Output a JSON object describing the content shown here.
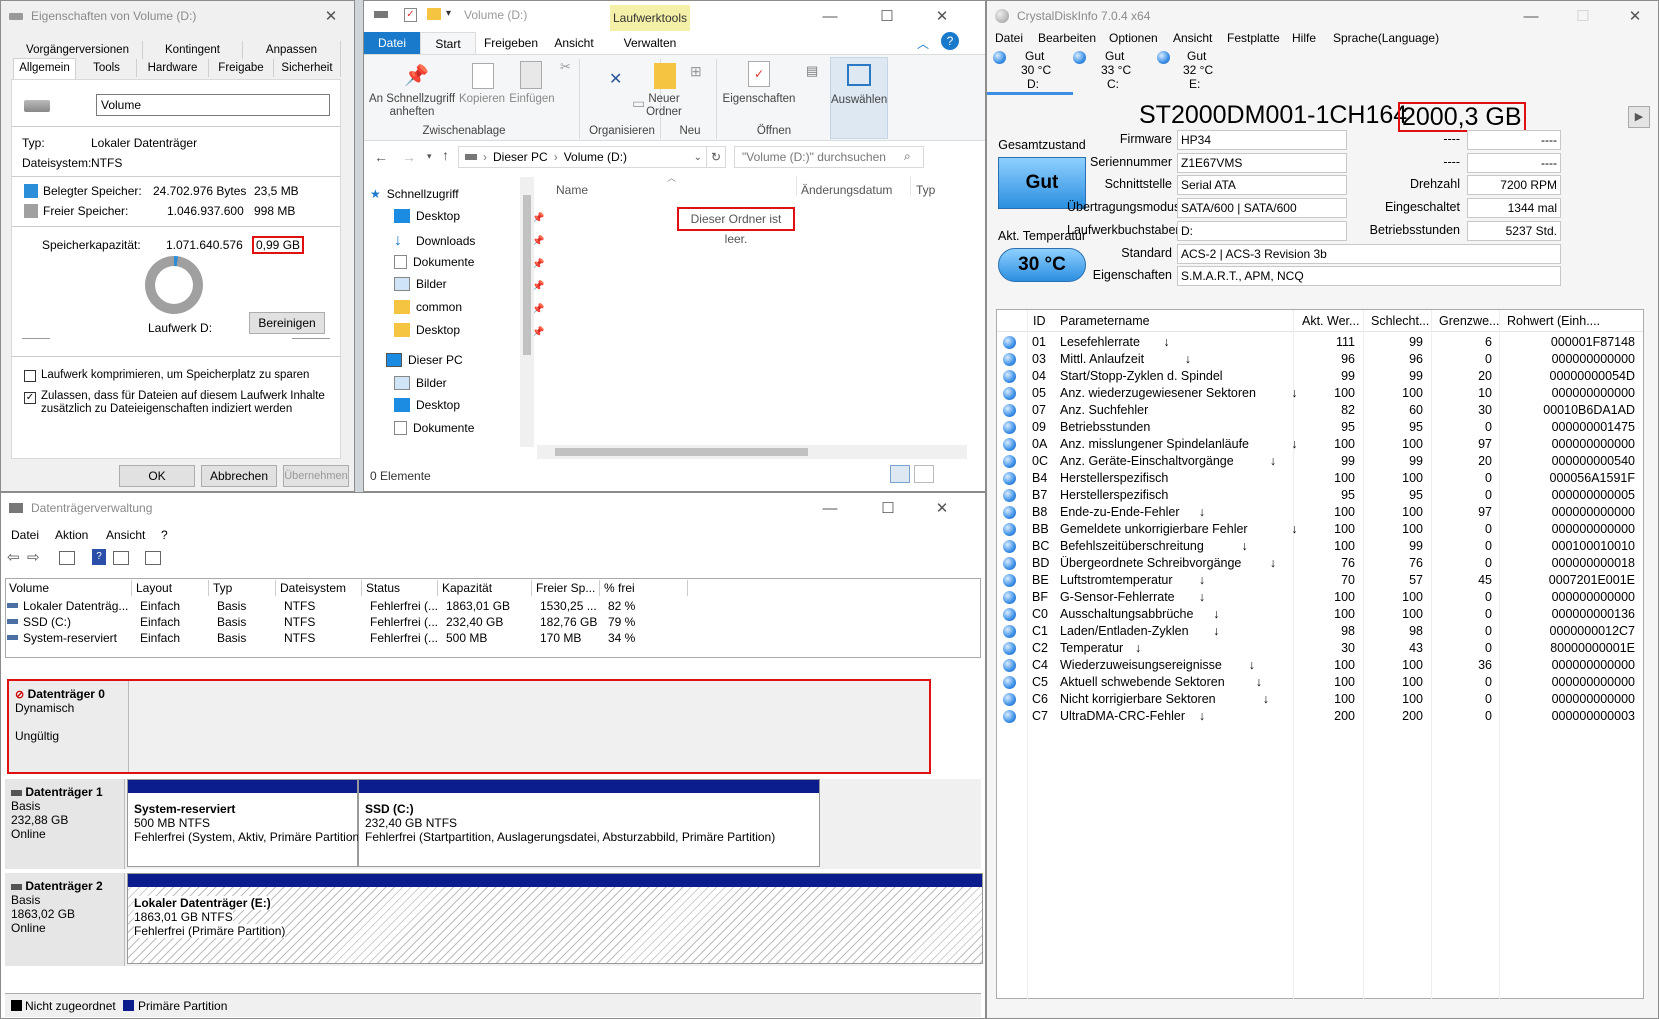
{
  "props": {
    "title": "Eigenschaften von Volume (D:)",
    "tabs_row1": [
      "Vorgängerversionen",
      "Kontingent",
      "Anpassen"
    ],
    "tabs_row2": [
      "Allgemein",
      "Tools",
      "Hardware",
      "Freigabe",
      "Sicherheit"
    ],
    "volume_name": "Volume",
    "type_label": "Typ:",
    "type_value": "Lokaler Datenträger",
    "fs_label": "Dateisystem:",
    "fs_value": "NTFS",
    "used_label": "Belegter Speicher:",
    "used_bytes": "24.702.976 Bytes",
    "used_mb": "23,5 MB",
    "free_label": "Freier Speicher:",
    "free_bytes": "1.046.937.600",
    "free_mb": "998 MB",
    "cap_label": "Speicherkapazität:",
    "cap_bytes": "1.071.640.576",
    "cap_gb": "0,99 GB",
    "drive_label": "Laufwerk D:",
    "cleanup": "Bereinigen",
    "compress": "Laufwerk komprimieren, um Speicherplatz zu sparen",
    "index_line1": "Zulassen, dass für Dateien auf diesem Laufwerk Inhalte",
    "index_line2": "zusätzlich zu Dateieigenschaften indiziert werden",
    "ok": "OK",
    "cancel": "Abbrechen",
    "apply": "Übernehmen",
    "used_color": "#2a8fd8",
    "free_color": "#a0a0a0"
  },
  "explorer": {
    "title": "Volume (D:)",
    "context_tab": "Laufwerktools",
    "tabs": [
      "Datei",
      "Start",
      "Freigeben",
      "Ansicht",
      "Verwalten"
    ],
    "ribbon": {
      "pin_line1": "An Schnellzugriff",
      "pin_line2": "anheften",
      "copy": "Kopieren",
      "paste": "Einfügen",
      "new_folder_line1": "Neuer",
      "new_folder_line2": "Ordner",
      "properties": "Eigenschaften",
      "select": "Auswählen",
      "group_clipboard": "Zwischenablage",
      "group_organize": "Organisieren",
      "group_new": "Neu",
      "group_open": "Öffnen"
    },
    "breadcrumb": [
      "Dieser PC",
      "Volume (D:)"
    ],
    "search_placeholder": "\"Volume (D:)\" durchsuchen",
    "nav": [
      {
        "label": "Schnellzugriff"
      },
      {
        "label": "Desktop"
      },
      {
        "label": "Downloads"
      },
      {
        "label": "Dokumente"
      },
      {
        "label": "Bilder"
      },
      {
        "label": "common"
      },
      {
        "label": "Desktop"
      },
      {
        "label": "Dieser PC"
      },
      {
        "label": "Bilder"
      },
      {
        "label": "Desktop"
      },
      {
        "label": "Dokumente"
      }
    ],
    "col_name": "Name",
    "col_date": "Änderungsdatum",
    "col_type": "Typ",
    "empty_msg": "Dieser Ordner ist leer.",
    "status": "0 Elemente"
  },
  "dm": {
    "title": "Datenträgerverwaltung",
    "menu": [
      "Datei",
      "Aktion",
      "Ansicht",
      "?"
    ],
    "columns": [
      "Volume",
      "Layout",
      "Typ",
      "Dateisystem",
      "Status",
      "Kapazität",
      "Freier Sp...",
      "% frei"
    ],
    "rows": [
      [
        "Lokaler Datenträg...",
        "Einfach",
        "Basis",
        "NTFS",
        "Fehlerfrei (...",
        "1863,01 GB",
        "1530,25 ...",
        "82 %"
      ],
      [
        "SSD (C:)",
        "Einfach",
        "Basis",
        "NTFS",
        "Fehlerfrei (...",
        "232,40 GB",
        "182,76 GB",
        "79 %"
      ],
      [
        "System-reserviert",
        "Einfach",
        "Basis",
        "NTFS",
        "Fehlerfrei (...",
        "500 MB",
        "170 MB",
        "34 %"
      ]
    ],
    "disk0": {
      "name": "Datenträger 0",
      "type": "Dynamisch",
      "status": "Ungültig"
    },
    "disk1": {
      "name": "Datenträger 1",
      "type": "Basis",
      "size": "232,88 GB",
      "status": "Online",
      "p1_name": "System-reserviert",
      "p1_size": "500 MB NTFS",
      "p1_status": "Fehlerfrei (System, Aktiv, Primäre Partition)",
      "p2_name": "SSD  (C:)",
      "p2_size": "232,40 GB NTFS",
      "p2_status": "Fehlerfrei (Startpartition, Auslagerungsdatei, Absturzabbild, Primäre Partition)"
    },
    "disk2": {
      "name": "Datenträger 2",
      "type": "Basis",
      "size": "1863,02 GB",
      "status": "Online",
      "p1_name": "Lokaler Datenträger  (E:)",
      "p1_size": "1863,01 GB NTFS",
      "p1_status": "Fehlerfrei (Primäre Partition)"
    },
    "legend_unalloc": "Nicht zugeordnet",
    "legend_primary": "Primäre Partition",
    "primary_color": "#0b1d8c"
  },
  "cdi": {
    "title": "CrystalDiskInfo 7.0.4 x64",
    "menu": [
      "Datei",
      "Bearbeiten",
      "Optionen",
      "Ansicht",
      "Festplatte",
      "Hilfe",
      "Sprache(Language)"
    ],
    "drives": [
      {
        "state": "Gut",
        "temp": "30 °C",
        "letter": "D:"
      },
      {
        "state": "Gut",
        "temp": "33 °C",
        "letter": "C:"
      },
      {
        "state": "Gut",
        "temp": "32 °C",
        "letter": "E:"
      }
    ],
    "model": "ST2000DM001-1CH164",
    "capacity": "2000,3 GB",
    "health_label": "Gesamtzustand",
    "health_value": "Gut",
    "temp_label": "Akt. Temperatur",
    "temp_value": "30 °C",
    "fields_left": [
      {
        "label": "Firmware",
        "value": "HP34"
      },
      {
        "label": "Seriennummer",
        "value": "Z1E67VMS"
      },
      {
        "label": "Schnittstelle",
        "value": "Serial ATA"
      },
      {
        "label": "Übertragungsmodus",
        "value": "SATA/600 | SATA/600"
      },
      {
        "label": "Laufwerkbuchstaben",
        "value": "D:"
      },
      {
        "label": "Standard",
        "value": "ACS-2 | ACS-3 Revision 3b"
      },
      {
        "label": "Eigenschaften",
        "value": "S.M.A.R.T., APM, NCQ"
      }
    ],
    "fields_right": [
      {
        "label": "----",
        "value": "----"
      },
      {
        "label": "----",
        "value": "----"
      },
      {
        "label": "Drehzahl",
        "value": "7200 RPM"
      },
      {
        "label": "Eingeschaltet",
        "value": "1344 mal"
      },
      {
        "label": "Betriebsstunden",
        "value": "5237 Std."
      }
    ],
    "smart_headers": [
      "ID",
      "Parametername",
      "Akt. Wer...",
      "Schlecht...",
      "Grenzwe...",
      "Rohwert (Einh...."
    ],
    "smart": [
      [
        "01",
        "Lesefehlerrate",
        "111",
        "99",
        "6",
        "000001F87148"
      ],
      [
        "03",
        "Mittl. Anlaufzeit",
        "96",
        "96",
        "0",
        "000000000000"
      ],
      [
        "04",
        "Start/Stopp-Zyklen d. Spindel",
        "99",
        "99",
        "20",
        "00000000054D"
      ],
      [
        "05",
        "Anz. wiederzugewiesener Sektoren",
        "100",
        "100",
        "10",
        "000000000000"
      ],
      [
        "07",
        "Anz. Suchfehler",
        "82",
        "60",
        "30",
        "00010B6DA1AD"
      ],
      [
        "09",
        "Betriebsstunden",
        "95",
        "95",
        "0",
        "000000001475"
      ],
      [
        "0A",
        "Anz. misslungener Spindelanläufe",
        "100",
        "100",
        "97",
        "000000000000"
      ],
      [
        "0C",
        "Anz. Geräte-Einschaltvorgänge",
        "99",
        "99",
        "20",
        "000000000540"
      ],
      [
        "B4",
        "Herstellerspezifisch",
        "100",
        "100",
        "0",
        "000056A1591F"
      ],
      [
        "B7",
        "Herstellerspezifisch",
        "95",
        "95",
        "0",
        "000000000005"
      ],
      [
        "B8",
        "Ende-zu-Ende-Fehler",
        "100",
        "100",
        "97",
        "000000000000"
      ],
      [
        "BB",
        "Gemeldete unkorrigierbare Fehler",
        "100",
        "100",
        "0",
        "000000000000"
      ],
      [
        "BC",
        "Befehlszeitüberschreitung",
        "100",
        "99",
        "0",
        "000100010010"
      ],
      [
        "BD",
        "Übergeordnete Schreibvorgänge",
        "76",
        "76",
        "0",
        "000000000018"
      ],
      [
        "BE",
        "Luftstromtemperatur",
        "70",
        "57",
        "45",
        "0007201E001E"
      ],
      [
        "BF",
        "G-Sensor-Fehlerrate",
        "100",
        "100",
        "0",
        "000000000000"
      ],
      [
        "C0",
        "Ausschaltungsabbrüche",
        "100",
        "100",
        "0",
        "000000000136"
      ],
      [
        "C1",
        "Laden/Entladen-Zyklen",
        "98",
        "98",
        "0",
        "0000000012C7"
      ],
      [
        "C2",
        "Temperatur",
        "30",
        "43",
        "0",
        "80000000001E"
      ],
      [
        "C4",
        "Wiederzuweisungsereignisse",
        "100",
        "100",
        "36",
        "000000000000"
      ],
      [
        "C5",
        "Aktuell schwebende Sektoren",
        "100",
        "100",
        "0",
        "000000000000"
      ],
      [
        "C6",
        "Nicht korrigierbare Sektoren",
        "100",
        "100",
        "0",
        "000000000000"
      ],
      [
        "C7",
        "UltraDMA-CRC-Fehler",
        "200",
        "200",
        "0",
        "000000000003"
      ]
    ],
    "good_color": "#3a8ee6"
  }
}
